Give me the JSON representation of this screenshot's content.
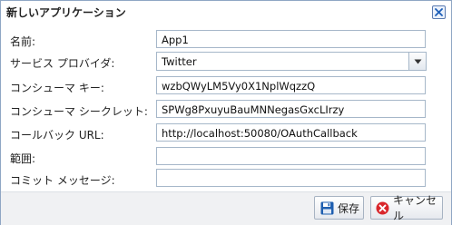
{
  "dialog": {
    "title": "新しいアプリケーション"
  },
  "form": {
    "name": {
      "label": "名前:",
      "value": "App1"
    },
    "service_provider": {
      "label": "サービス プロバイダ:",
      "value": "Twitter"
    },
    "consumer_key": {
      "label": "コンシューマ キー:",
      "value": "wzbQWyLM5Vy0X1NplWqzzQ"
    },
    "consumer_secret": {
      "label": "コンシューマ シークレット:",
      "value": "SPWg8PxuyuBauMNNegasGxcLIrzy"
    },
    "callback_url": {
      "label": "コールバック URL:",
      "value": "http://localhost:50080/OAuthCallback"
    },
    "scope": {
      "label": "範囲:",
      "value": ""
    },
    "commit_message": {
      "label": "コミット メッセージ:",
      "value": ""
    }
  },
  "footer": {
    "save_label": "保存",
    "cancel_label": "キャンセル"
  },
  "icons": {
    "close": "close-icon",
    "dropdown": "chevron-down-icon",
    "save": "floppy-disk-icon",
    "cancel": "cancel-icon"
  },
  "colors": {
    "close_x": "#1d5fb8",
    "save_icon": "#1f5fb0",
    "cancel_icon": "#d9262b"
  }
}
